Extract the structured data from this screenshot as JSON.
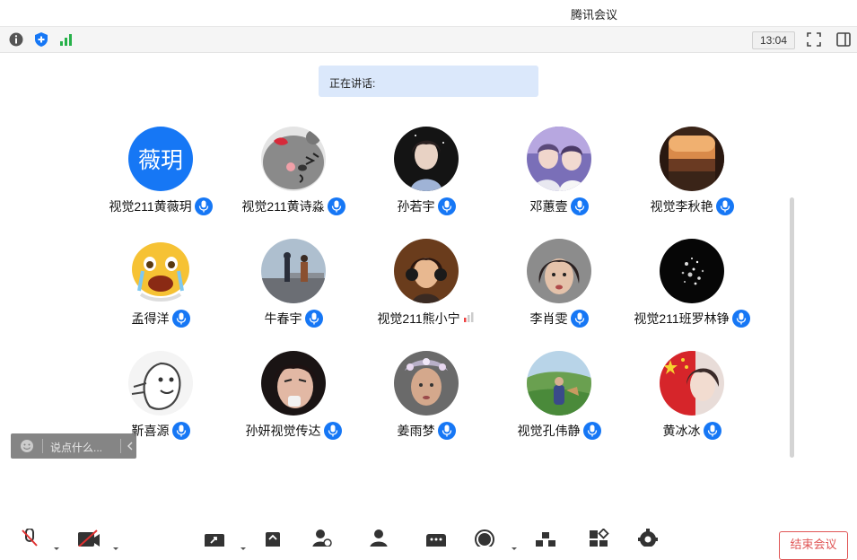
{
  "window": {
    "title": "腾讯会议"
  },
  "toolbar": {
    "timer": "13:04",
    "icons": [
      "info-icon",
      "shield-icon",
      "signal-icon",
      "fullscreen-icon",
      "sidebar-toggle-icon"
    ]
  },
  "speaking": {
    "label": "正在讲话:"
  },
  "participants": [
    {
      "name": "视觉211黄薇玥",
      "avatar_text": "薇玥",
      "mic": "on"
    },
    {
      "name": "视觉211黄诗淼",
      "mic": "on"
    },
    {
      "name": "孙若宇",
      "mic": "on"
    },
    {
      "name": "邓蕙壹",
      "mic": "on"
    },
    {
      "name": "视觉李秋艳",
      "mic": "on"
    },
    {
      "name": "孟得洋",
      "mic": "on"
    },
    {
      "name": "牛春宇",
      "mic": "on"
    },
    {
      "name": "视觉211熊小宁",
      "mic": "level"
    },
    {
      "name": "李肖雯",
      "mic": "on"
    },
    {
      "name": "视觉211班罗林铮",
      "mic": "on"
    },
    {
      "name": "靳喜源",
      "mic": "on"
    },
    {
      "name": "孙妍视觉传达",
      "mic": "on"
    },
    {
      "name": "姜雨梦",
      "mic": "on"
    },
    {
      "name": "视觉孔伟静",
      "mic": "on"
    },
    {
      "name": "黄冰冰",
      "mic": "on"
    }
  ],
  "chat": {
    "placeholder": "说点什么..."
  },
  "bottom": {
    "end_label": "结束会议",
    "icons": [
      "mic-muted-icon",
      "camera-off-icon",
      "share-screen-icon",
      "security-icon",
      "invite-icon",
      "members-icon",
      "chat-icon",
      "record-icon",
      "breakout-icon",
      "apps-icon",
      "settings-icon"
    ]
  },
  "colors": {
    "accent": "#1677f5",
    "speaking_bg": "#dbe8fb",
    "end": "#e05555"
  }
}
